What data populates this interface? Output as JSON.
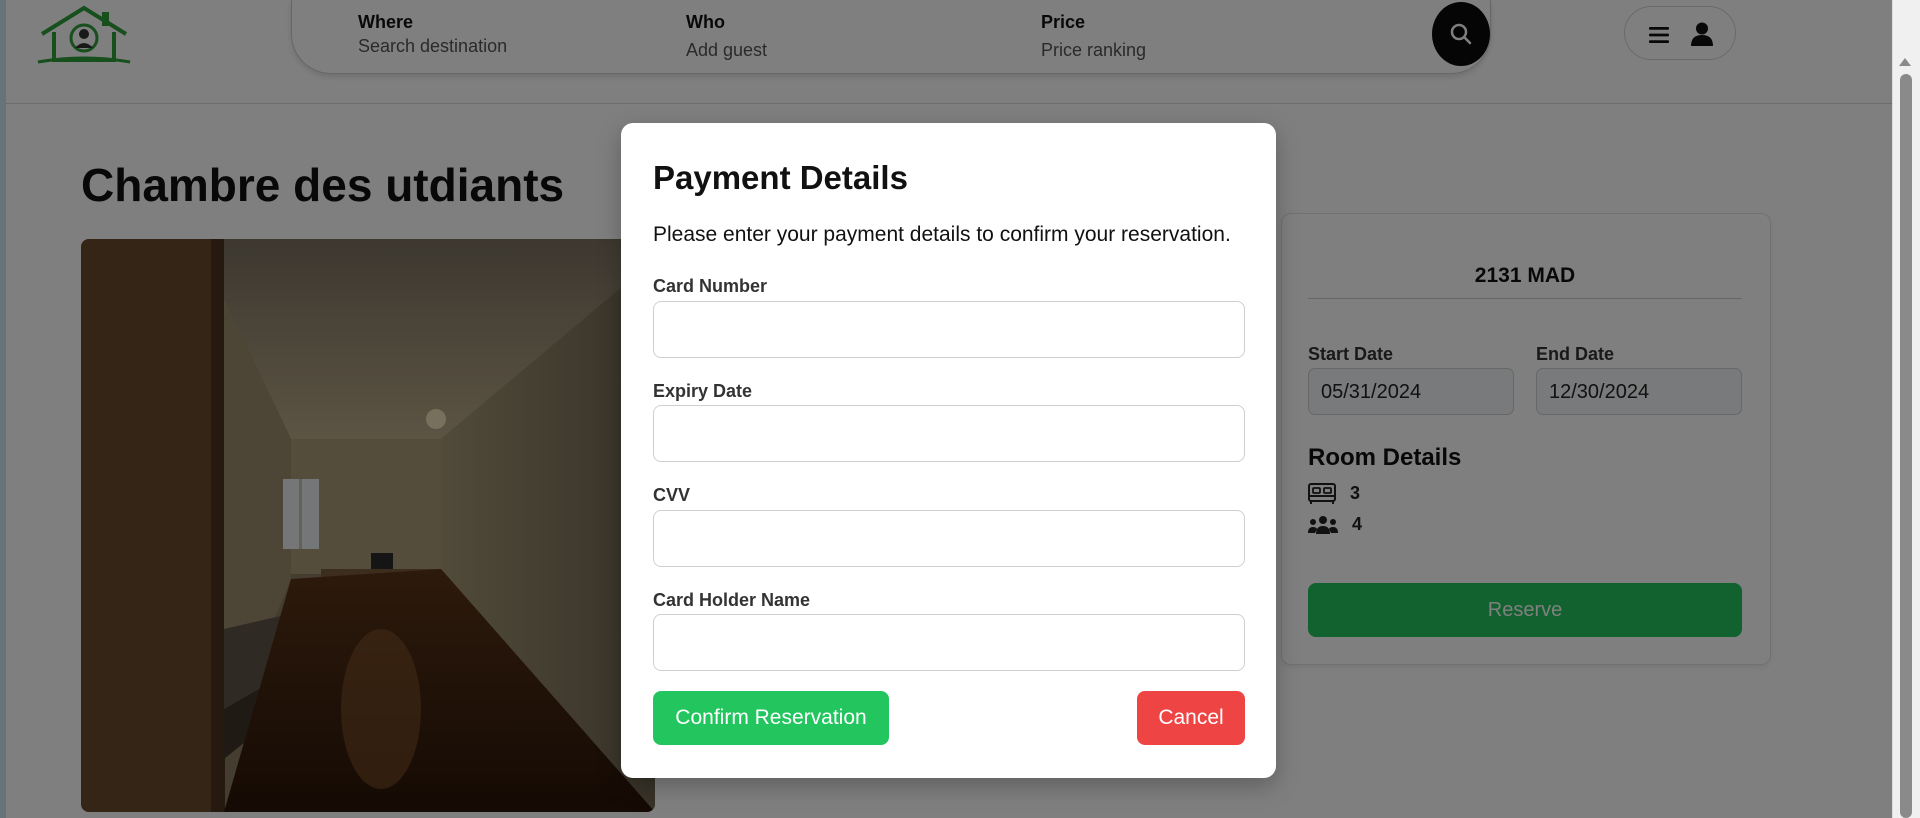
{
  "header": {
    "search": {
      "where_label": "Where",
      "where_placeholder": "Search destination",
      "who_label": "Who",
      "who_value": "Add guest",
      "price_label": "Price",
      "price_value": "Price ranking"
    }
  },
  "listing": {
    "title": "Chambre des utdiants"
  },
  "booking": {
    "price": "2131 MAD",
    "start_label": "Start Date",
    "start_value": "05/31/2024",
    "end_label": "End Date",
    "end_value": "12/30/2024",
    "room_details_title": "Room Details",
    "beds": "3",
    "guests": "4",
    "reserve_label": "Reserve"
  },
  "modal": {
    "title": "Payment Details",
    "description": "Please enter your payment details to confirm your reservation.",
    "fields": [
      {
        "label": "Card Number",
        "value": ""
      },
      {
        "label": "Expiry Date",
        "value": ""
      },
      {
        "label": "CVV",
        "value": ""
      },
      {
        "label": "Card Holder Name",
        "value": ""
      }
    ],
    "confirm_label": "Confirm Reservation",
    "cancel_label": "Cancel"
  },
  "colors": {
    "accent_green": "#22c55e",
    "cancel_red": "#ef4444",
    "overlay": "rgba(0,0,0,0.5)",
    "logo_green": "#2e9e3a"
  }
}
